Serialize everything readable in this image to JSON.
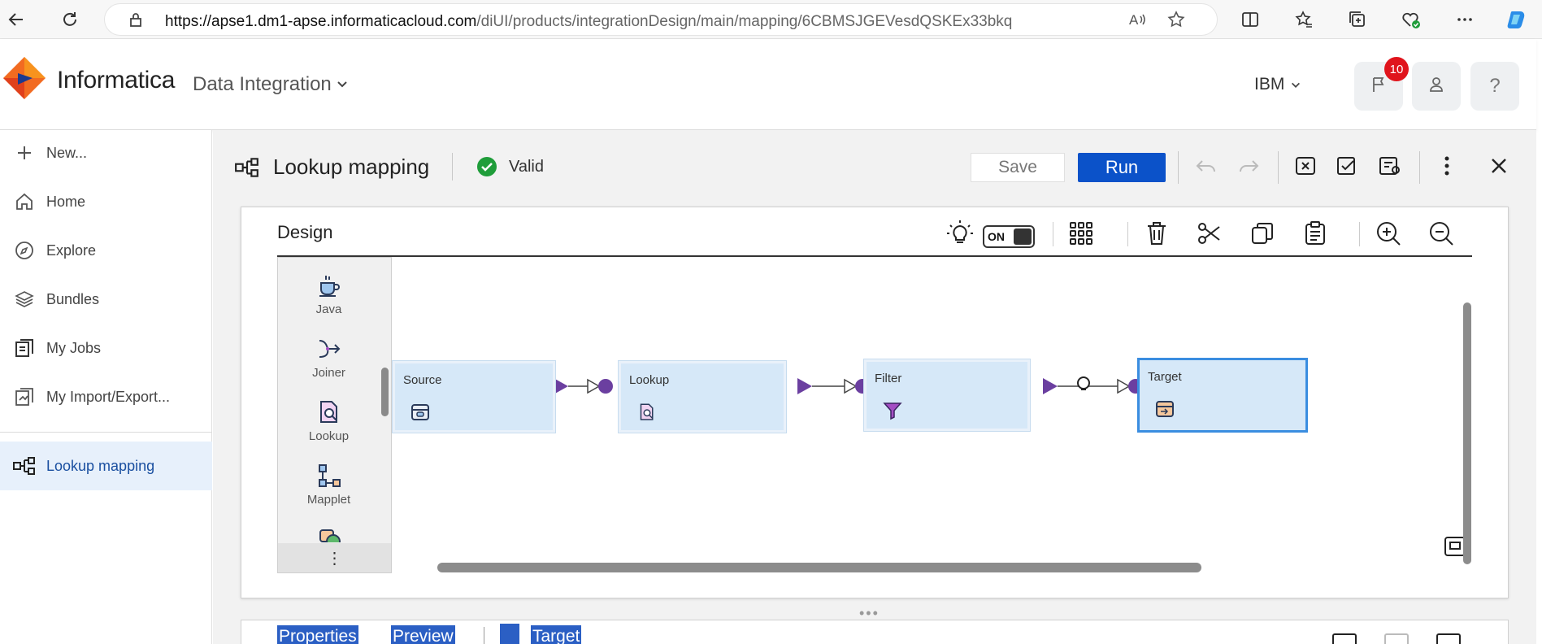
{
  "browser": {
    "url_host": "https://apse1.dm1-apse.informaticacloud.com",
    "url_path": "/diUI/products/integrationDesign/main/mapping/6CBMSJGEVesdQSKEx33bkq",
    "icons": [
      "back-icon",
      "refresh-icon",
      "lock-icon",
      "read-aloud-icon",
      "favorite-star-icon",
      "split-screen-icon",
      "favorites-icon",
      "collections-icon",
      "browser-health-icon",
      "more-icon",
      "copilot-icon"
    ]
  },
  "header": {
    "brand": "Informatica",
    "product": "Data Integration",
    "org": "IBM",
    "notification_count": "10",
    "help_label": "?"
  },
  "sidebar": {
    "items": [
      {
        "label": "New...",
        "icon": "plus-icon"
      },
      {
        "label": "Home",
        "icon": "home-icon"
      },
      {
        "label": "Explore",
        "icon": "compass-icon"
      },
      {
        "label": "Bundles",
        "icon": "layers-icon"
      },
      {
        "label": "My Jobs",
        "icon": "jobs-icon"
      },
      {
        "label": "My Import/Export...",
        "icon": "import-export-icon"
      }
    ],
    "active_item": {
      "label": "Lookup mapping",
      "icon": "mapping-icon"
    }
  },
  "toolbar": {
    "title": "Lookup mapping",
    "status": "Valid",
    "save_label": "Save",
    "run_label": "Run",
    "colors": {
      "run": "#0b52c9",
      "valid": "#1f9d3a"
    }
  },
  "design": {
    "title": "Design",
    "toggle_label": "ON",
    "palette": [
      {
        "label": "Java",
        "icon": "java-cup-icon"
      },
      {
        "label": "Joiner",
        "icon": "joiner-icon"
      },
      {
        "label": "Lookup",
        "icon": "lookup-icon"
      },
      {
        "label": "Mapplet",
        "icon": "mapplet-icon"
      }
    ],
    "palette_more": "⋮",
    "nodes": [
      {
        "name": "Source",
        "icon": "source-icon"
      },
      {
        "name": "Lookup",
        "icon": "lookup-icon"
      },
      {
        "name": "Filter",
        "icon": "filter-funnel-icon"
      },
      {
        "name": "Target",
        "icon": "target-icon"
      }
    ]
  },
  "bottom": {
    "tabs": [
      "Properties",
      "Preview",
      "Target"
    ]
  }
}
